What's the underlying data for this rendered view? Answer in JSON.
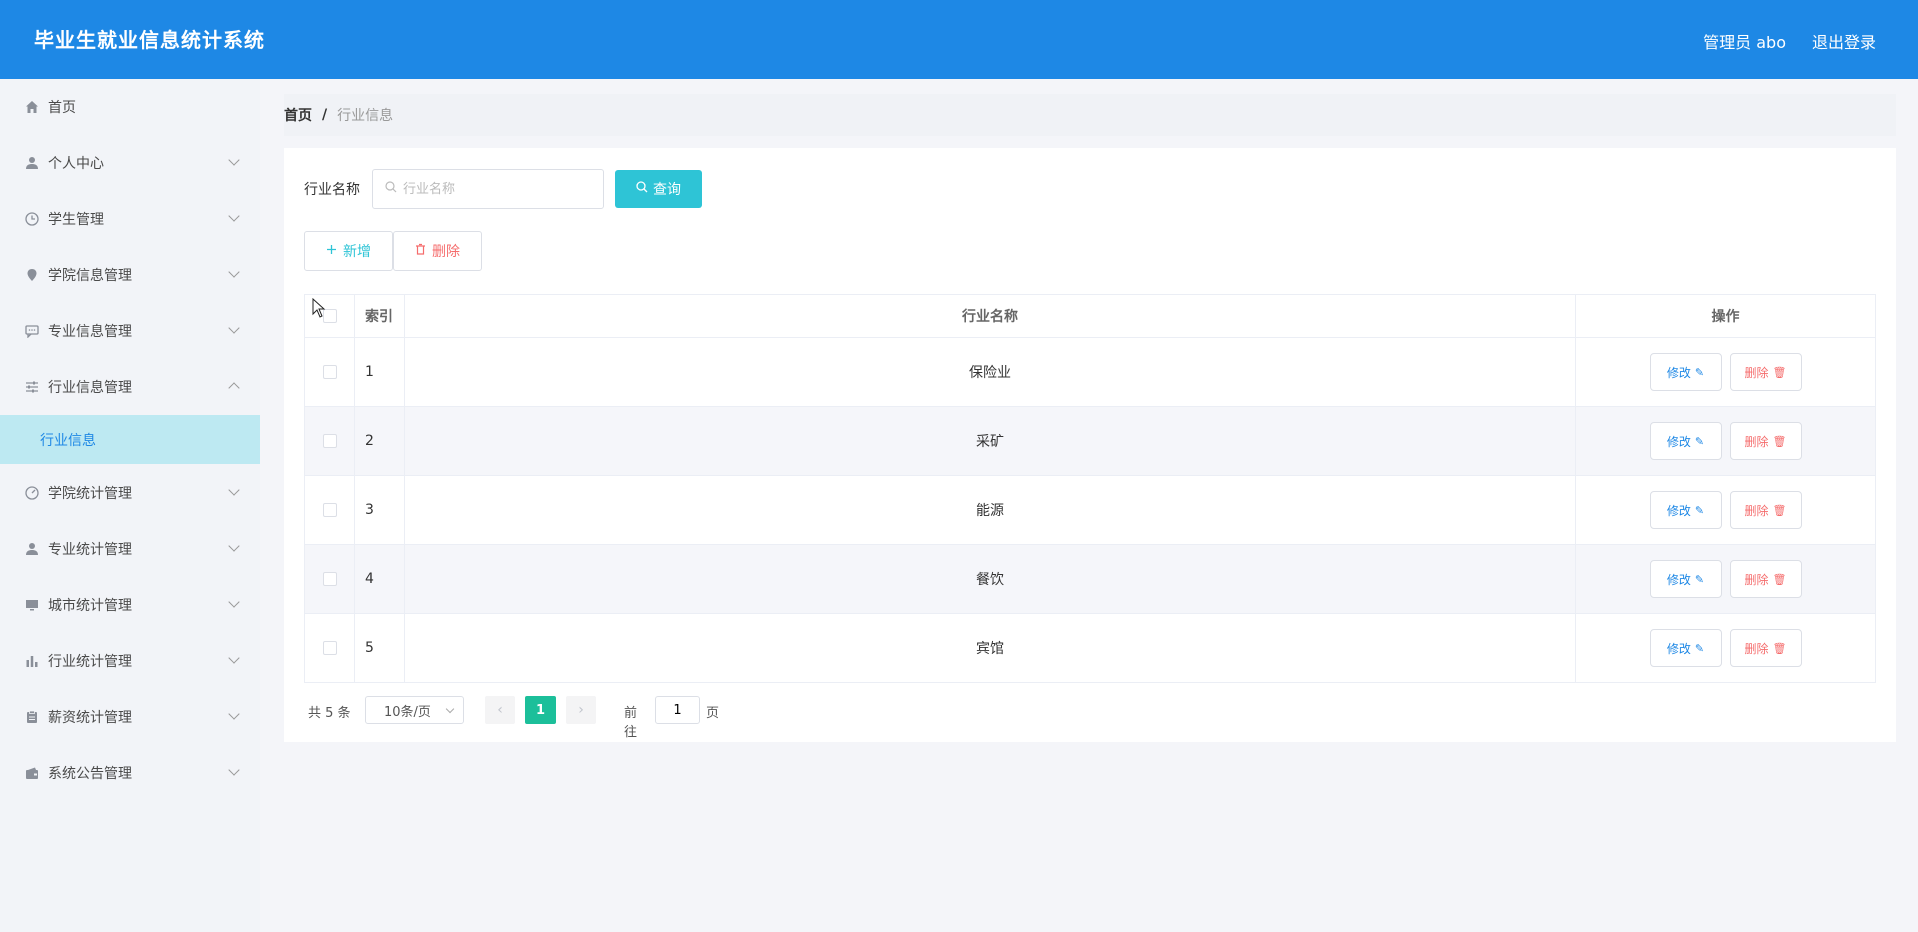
{
  "header": {
    "title": "毕业生就业信息统计系统",
    "user": "管理员 abo",
    "logout": "退出登录"
  },
  "sidebar": {
    "items": [
      {
        "label": "首页",
        "icon": "home-icon",
        "expandable": false
      },
      {
        "label": "个人中心",
        "icon": "user-icon",
        "expandable": true
      },
      {
        "label": "学生管理",
        "icon": "clock-icon",
        "expandable": true
      },
      {
        "label": "学院信息管理",
        "icon": "location-icon",
        "expandable": true
      },
      {
        "label": "专业信息管理",
        "icon": "chat-icon",
        "expandable": true
      },
      {
        "label": "行业信息管理",
        "icon": "sliders-icon",
        "expandable": true,
        "expanded": true
      },
      {
        "label": "学院统计管理",
        "icon": "gauge-icon",
        "expandable": true
      },
      {
        "label": "专业统计管理",
        "icon": "person-icon",
        "expandable": true
      },
      {
        "label": "城市统计管理",
        "icon": "monitor-icon",
        "expandable": true
      },
      {
        "label": "行业统计管理",
        "icon": "bar-chart-icon",
        "expandable": true
      },
      {
        "label": "薪资统计管理",
        "icon": "clipboard-icon",
        "expandable": true
      },
      {
        "label": "系统公告管理",
        "icon": "wallet-icon",
        "expandable": true
      }
    ],
    "active_sub": "行业信息"
  },
  "breadcrumb": {
    "home": "首页",
    "separator": "/",
    "current": "行业信息"
  },
  "search": {
    "label": "行业名称",
    "placeholder": "行业名称",
    "query_button": "查询"
  },
  "actions": {
    "add": "新增",
    "delete": "删除"
  },
  "table": {
    "headers": {
      "index": "索引",
      "name": "行业名称",
      "ops": "操作"
    },
    "rows": [
      {
        "index": "1",
        "name": "保险业"
      },
      {
        "index": "2",
        "name": "采矿"
      },
      {
        "index": "3",
        "name": "能源"
      },
      {
        "index": "4",
        "name": "餐饮"
      },
      {
        "index": "5",
        "name": "宾馆"
      }
    ],
    "edit_label": "修改",
    "delete_label": "删除"
  },
  "pagination": {
    "total": "共 5 条",
    "page_size": "10条/页",
    "current_page": "1",
    "goto_label": "前往",
    "goto_value": "1",
    "page_suffix": "页"
  },
  "colors": {
    "header": "#1e88e5",
    "accent": "#2ec4d6",
    "danger": "#f56c6c",
    "page_active": "#1cbf9a",
    "active_sub_bg": "#bde9f2"
  }
}
